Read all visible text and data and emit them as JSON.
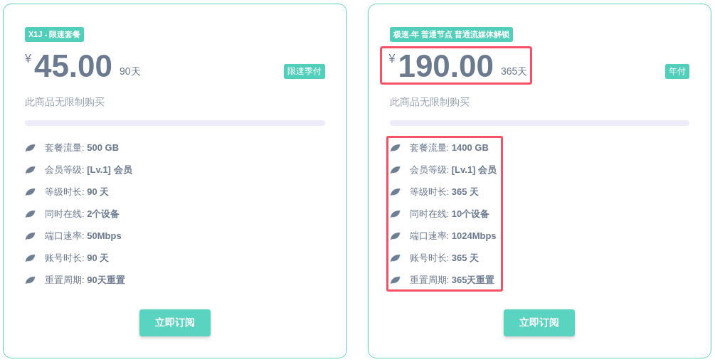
{
  "plans": [
    {
      "tag": "X1J - 限速套餐",
      "currency": "¥",
      "price": "45.00",
      "period": "90天",
      "billing": "限速季付",
      "note": "此商品无限制购买",
      "price_highlighted": false,
      "features_highlighted": false,
      "button": "立即订阅",
      "features": [
        {
          "label": "套餐流量:",
          "value": "500 GB"
        },
        {
          "label": "会员等级:",
          "value": "[Lv.1] 会员"
        },
        {
          "label": "等级时长:",
          "value": "90 天"
        },
        {
          "label": "同时在线:",
          "value": "2个设备"
        },
        {
          "label": "端口速率:",
          "value": "50Mbps"
        },
        {
          "label": "账号时长:",
          "value": "90 天"
        },
        {
          "label": "重置周期:",
          "value": "90天重置"
        }
      ]
    },
    {
      "tag": "极速-年 普通节点 普通流媒体解锁",
      "currency": "¥",
      "price": "190.00",
      "period": "365天",
      "billing": "年付",
      "note": "此商品无限制购买",
      "price_highlighted": true,
      "features_highlighted": true,
      "button": "立即订阅",
      "features": [
        {
          "label": "套餐流量:",
          "value": "1400 GB"
        },
        {
          "label": "会员等级:",
          "value": "[Lv.1] 会员"
        },
        {
          "label": "等级时长:",
          "value": "365 天"
        },
        {
          "label": "同时在线:",
          "value": "10个设备"
        },
        {
          "label": "端口速率:",
          "value": "1024Mbps"
        },
        {
          "label": "账号时长:",
          "value": "365 天"
        },
        {
          "label": "重置周期:",
          "value": "365天重置"
        }
      ]
    }
  ]
}
